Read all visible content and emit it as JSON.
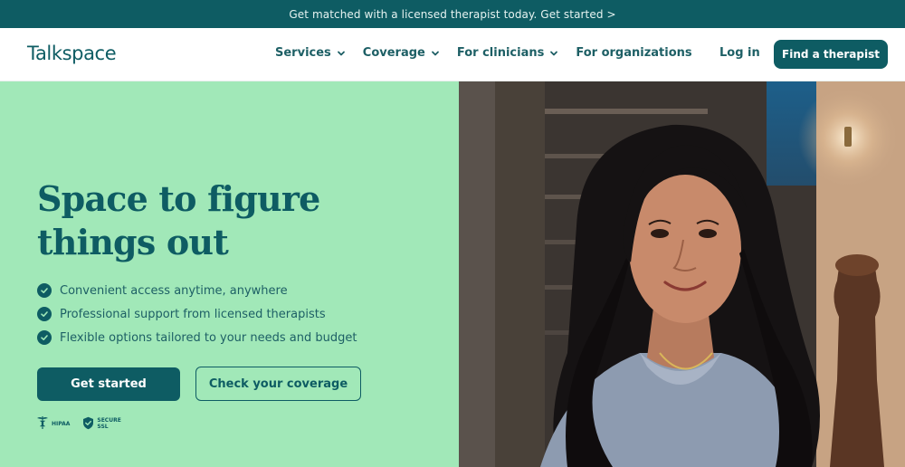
{
  "banner": {
    "text": "Get matched with a licensed therapist today. Get started >"
  },
  "nav": {
    "logo": "Talkspace",
    "links": [
      {
        "label": "Services",
        "dropdown": true
      },
      {
        "label": "Coverage",
        "dropdown": true
      },
      {
        "label": "For clinicians",
        "dropdown": true
      },
      {
        "label": "For organizations",
        "dropdown": false
      }
    ],
    "login": "Log in",
    "cta": "Find a therapist"
  },
  "hero": {
    "headline": "Space to figure things out",
    "features": [
      "Convenient access anytime, anywhere",
      "Professional support from licensed therapists",
      "Flexible options tailored to your needs and budget"
    ],
    "primary_button": "Get started",
    "secondary_button": "Check your coverage",
    "badges": [
      {
        "icon": "caduceus-icon",
        "label": "HIPAA"
      },
      {
        "icon": "shield-check-icon",
        "label_line1": "SECURE",
        "label_line2": "SSL"
      }
    ]
  },
  "colors": {
    "brand": "#0e5c63",
    "hero_bg": "#a1e8b8",
    "white": "#ffffff"
  }
}
